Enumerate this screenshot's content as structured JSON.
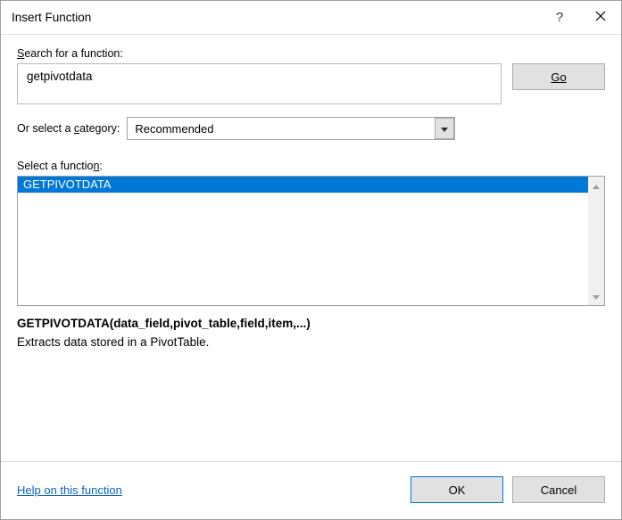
{
  "titlebar": {
    "title": "Insert Function"
  },
  "labels": {
    "search_prefix": "S",
    "search_rest": "earch for a function:",
    "category_prefix": "Or select a ",
    "category_underline": "c",
    "category_rest": "ategory:",
    "select_func_prefix": "Select a functio",
    "select_func_underline": "n",
    "select_func_rest": ":"
  },
  "search": {
    "value": "getpivotdata"
  },
  "buttons": {
    "go_underline": "G",
    "go_rest": "o",
    "ok": "OK",
    "cancel": "Cancel"
  },
  "category": {
    "selected": "Recommended"
  },
  "functions": {
    "items": [
      "GETPIVOTDATA"
    ]
  },
  "detail": {
    "signature": "GETPIVOTDATA(data_field,pivot_table,field,item,...)",
    "description": "Extracts data stored in a PivotTable."
  },
  "footer": {
    "help": "Help on this function"
  }
}
